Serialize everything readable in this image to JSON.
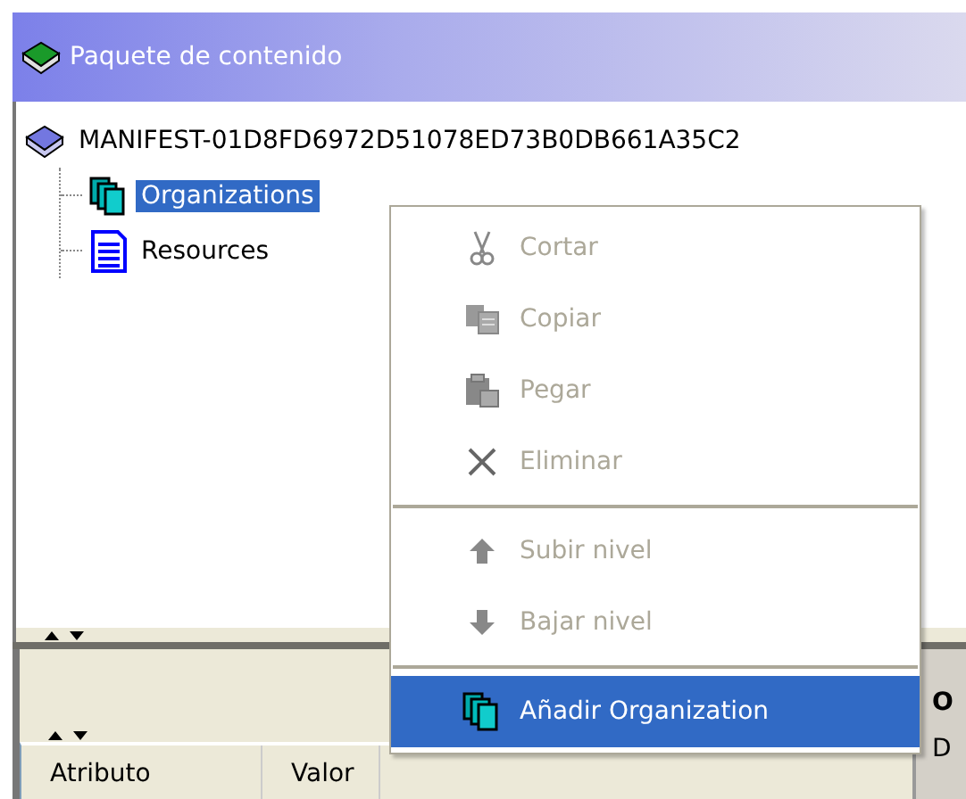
{
  "window": {
    "title": "Paquete de contenido"
  },
  "tree": [
    {
      "label": "MANIFEST-01D8FD6972D51078ED73B0DB661A35C2",
      "kind": "manifest",
      "selected": false,
      "children": [
        {
          "label": "Organizations",
          "kind": "organizations",
          "selected": true
        },
        {
          "label": "Resources",
          "kind": "resources",
          "selected": false
        }
      ]
    }
  ],
  "context_menu": {
    "groups": [
      [
        {
          "label": "Cortar",
          "kind": "cut",
          "disabled": true,
          "selected": false
        },
        {
          "label": "Copiar",
          "kind": "copy",
          "disabled": true,
          "selected": false
        },
        {
          "label": "Pegar",
          "kind": "paste",
          "disabled": true,
          "selected": false
        },
        {
          "label": "Eliminar",
          "kind": "delete",
          "disabled": true,
          "selected": false
        }
      ],
      [
        {
          "label": "Subir nivel",
          "kind": "up",
          "disabled": true,
          "selected": false
        },
        {
          "label": "Bajar nivel",
          "kind": "down",
          "disabled": true,
          "selected": false
        }
      ],
      [
        {
          "label": "Añadir Organization",
          "kind": "organizations",
          "disabled": false,
          "selected": true
        }
      ]
    ]
  },
  "attributes_table": {
    "columns": [
      "Atributo",
      "Valor"
    ]
  },
  "side_panel": {
    "heading": "O",
    "text": "D"
  }
}
